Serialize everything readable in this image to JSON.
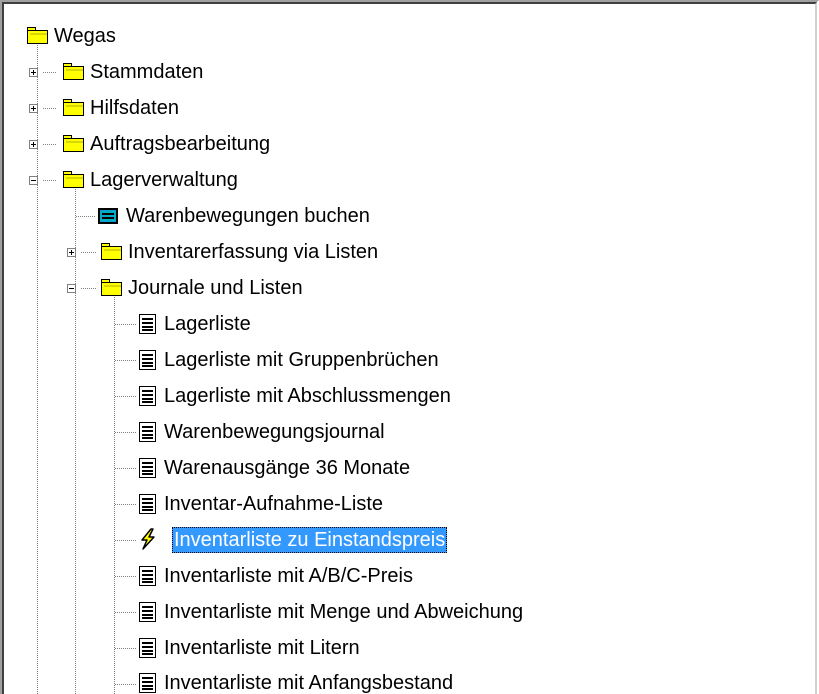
{
  "tree": {
    "root": {
      "label": "Wegas",
      "icon": "folder-icon"
    },
    "stammdaten": {
      "label": "Stammdaten",
      "icon": "folder-icon",
      "expanded": false
    },
    "hilfsdaten": {
      "label": "Hilfsdaten",
      "icon": "folder-icon",
      "expanded": false
    },
    "auftragsbearbeitung": {
      "label": "Auftragsbearbeitung",
      "icon": "folder-icon",
      "expanded": false
    },
    "lagerverwaltung": {
      "label": "Lagerverwaltung",
      "icon": "folder-icon",
      "expanded": true,
      "warenbewegungen": {
        "label": "Warenbewegungen buchen",
        "icon": "form-icon"
      },
      "inventarerfassung": {
        "label": "Inventarerfassung via Listen",
        "icon": "folder-icon",
        "expanded": false
      },
      "journale": {
        "label": "Journale und Listen",
        "icon": "folder-icon",
        "expanded": true,
        "items": [
          {
            "label": "Lagerliste",
            "icon": "report-icon"
          },
          {
            "label": "Lagerliste mit Gruppenbrüchen",
            "icon": "report-icon"
          },
          {
            "label": "Lagerliste mit Abschlussmengen",
            "icon": "report-icon"
          },
          {
            "label": "Warenbewegungsjournal",
            "icon": "report-icon"
          },
          {
            "label": "Warenausgänge 36 Monate",
            "icon": "report-icon"
          },
          {
            "label": "Inventar-Aufnahme-Liste",
            "icon": "report-icon"
          },
          {
            "label": "Inventarliste zu Einstandspreis",
            "icon": "lightning-icon",
            "selected": true
          },
          {
            "label": "Inventarliste mit A/B/C-Preis",
            "icon": "report-icon"
          },
          {
            "label": "Inventarliste mit Menge und Abweichung",
            "icon": "report-icon"
          },
          {
            "label": "Inventarliste mit Litern",
            "icon": "report-icon"
          },
          {
            "label": "Inventarliste mit Anfangsbestand",
            "icon": "report-icon"
          }
        ]
      }
    }
  },
  "colors": {
    "selection_background": "#3399ff",
    "folder_yellow": "#ffff00",
    "form_icon_cyan": "#00a8c8"
  }
}
